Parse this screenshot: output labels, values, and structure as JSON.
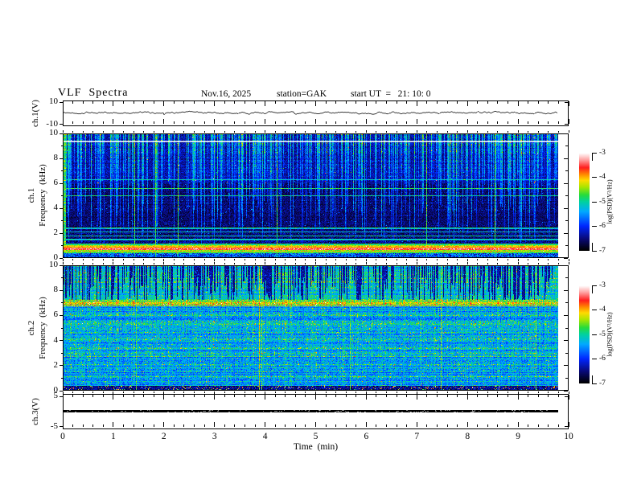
{
  "header": {
    "title": "VLF  Spectra",
    "date": "Nov.16, 2025",
    "station": "station=GAK",
    "start_ut": "start UT  =   21: 10: 0"
  },
  "time_axis": {
    "label": "Time  (min)",
    "tick_labels": [
      "0",
      "1",
      "2",
      "3",
      "4",
      "5",
      "6",
      "7",
      "8",
      "9",
      "10"
    ],
    "tick_values": [
      0,
      1,
      2,
      3,
      4,
      5,
      6,
      7,
      8,
      9,
      10
    ],
    "range_min": [
      0,
      10
    ],
    "minor_divisions": 5
  },
  "panels": {
    "ch1_wave": {
      "ylabel": "ch.1(V)",
      "ytick_labels": [
        "10",
        "-10"
      ],
      "ytick_values": [
        10,
        -10
      ],
      "range_V": [
        -10,
        10
      ]
    },
    "ch1_spec": {
      "ylabel_channel": "ch.1",
      "ylabel_axis": "Frequency  (kHz)",
      "ytick_labels": [
        "10",
        "8",
        "6",
        "4",
        "2",
        "0"
      ],
      "ytick_values": [
        10,
        8,
        6,
        4,
        2,
        0
      ],
      "range_kHz": [
        0,
        10
      ]
    },
    "ch2_spec": {
      "ylabel_channel": "ch.2",
      "ylabel_axis": "Frequency  (kHz)",
      "ytick_labels": [
        "10",
        "8",
        "6",
        "4",
        "2",
        "0"
      ],
      "ytick_values": [
        10,
        8,
        6,
        4,
        2,
        0
      ],
      "range_kHz": [
        0,
        10
      ]
    },
    "ch3_wave": {
      "ylabel": "ch.3(V)",
      "ytick_labels": [
        "5",
        "-5"
      ],
      "ytick_values": [
        5,
        -5
      ],
      "range_V": [
        -5,
        5
      ]
    }
  },
  "colorbars": [
    {
      "label": "log(PSD)(V²/Hz)",
      "tick_labels": [
        "-3",
        "-4",
        "-5",
        "-6",
        "-7"
      ],
      "tick_values": [
        -3,
        -4,
        -5,
        -6,
        -7
      ],
      "range": [
        -7,
        -3
      ]
    },
    {
      "label": "log(PSD)(V²/Hz)",
      "tick_labels": [
        "-3",
        "-4",
        "-5",
        "-6",
        "-7"
      ],
      "tick_values": [
        -3,
        -4,
        -5,
        -6,
        -7
      ],
      "range": [
        -7,
        -3
      ]
    }
  ],
  "colormap_stops": [
    [
      0.0,
      "#000000"
    ],
    [
      0.12,
      "#0a0a78"
    ],
    [
      0.25,
      "#0028ff"
    ],
    [
      0.4,
      "#00aaff"
    ],
    [
      0.5,
      "#00d2a0"
    ],
    [
      0.57,
      "#28dc3c"
    ],
    [
      0.65,
      "#aae600"
    ],
    [
      0.72,
      "#ffdc00"
    ],
    [
      0.78,
      "#ff8c00"
    ],
    [
      0.85,
      "#ff1e1e"
    ],
    [
      0.93,
      "#ffa0a0"
    ],
    [
      1.0,
      "#ffffff"
    ]
  ],
  "chart_data": [
    {
      "id": "ch1_voltage",
      "type": "line",
      "panel": "ch.1(V)",
      "x_range_min": [
        0,
        9.78
      ],
      "y_range_V": [
        -10,
        10
      ],
      "mean_V": 0.5,
      "noise_amplitude_V": 1.0,
      "description": "continuous broadband noisy voltage trace, roughly constant near 0 V"
    },
    {
      "id": "ch1_spectrogram",
      "type": "heatmap",
      "x_range_min": [
        0,
        9.78
      ],
      "y_range_kHz": [
        0,
        10
      ],
      "z_log_psd_range": [
        -7,
        -3
      ],
      "features": {
        "background_level": -6.65,
        "upper_background_level": -6.4,
        "vertical_streak_density": 0.5,
        "vertical_streak_level": -5.0,
        "vertical_streak_depth_kHz": [
          3.5,
          9.0
        ],
        "full_height_line_fraction": 0.012,
        "horizontal_lines_kHz": [
          6.3,
          5.6,
          5.0,
          2.35,
          2.05,
          1.75,
          1.45
        ],
        "horizontal_line_level": -5.15,
        "intense_band": {
          "from_kHz": 0.33,
          "to_kHz": 1.08,
          "peak_kHz": 0.7,
          "edge_level": -5.1,
          "peak_level": -3.8
        },
        "lowest_band_level": -5.9,
        "white_gap_row_kHz": 9.5
      }
    },
    {
      "id": "ch2_spectrogram",
      "type": "heatmap",
      "x_range_min": [
        0,
        9.78
      ],
      "y_range_kHz": [
        0,
        10
      ],
      "z_log_psd_range": [
        -7,
        -3
      ],
      "features": {
        "background_level": -5.55,
        "upper_region": {
          "above_kHz": 7.3,
          "level": -5.2,
          "dark_streak_density": 0.5,
          "dark_streak_level": -6.45,
          "dark_streak_depth_kHz": [
            0.8,
            3.4
          ]
        },
        "band_7kHz": {
          "from_kHz": 6.78,
          "to_kHz": 7.3,
          "level": -4.7
        },
        "mottled_band_centers_kHz": [
          1.0,
          1.6,
          2.2,
          2.8,
          3.4,
          4.1,
          4.7,
          5.4,
          6.1
        ],
        "bottom_band": {
          "below_kHz": 0.33,
          "level": -6.6,
          "hot_speckle_level": -4.0
        },
        "bright_column_fraction": 0.01
      }
    },
    {
      "id": "ch3_voltage",
      "type": "line",
      "panel": "ch.3(V)",
      "x_range_min": [
        0,
        9.78
      ],
      "y_range_V": [
        -5,
        5
      ],
      "mean_V": 0,
      "noise_amplitude_V": 0.1,
      "description": "flat heavy black trace at 0 V"
    }
  ]
}
